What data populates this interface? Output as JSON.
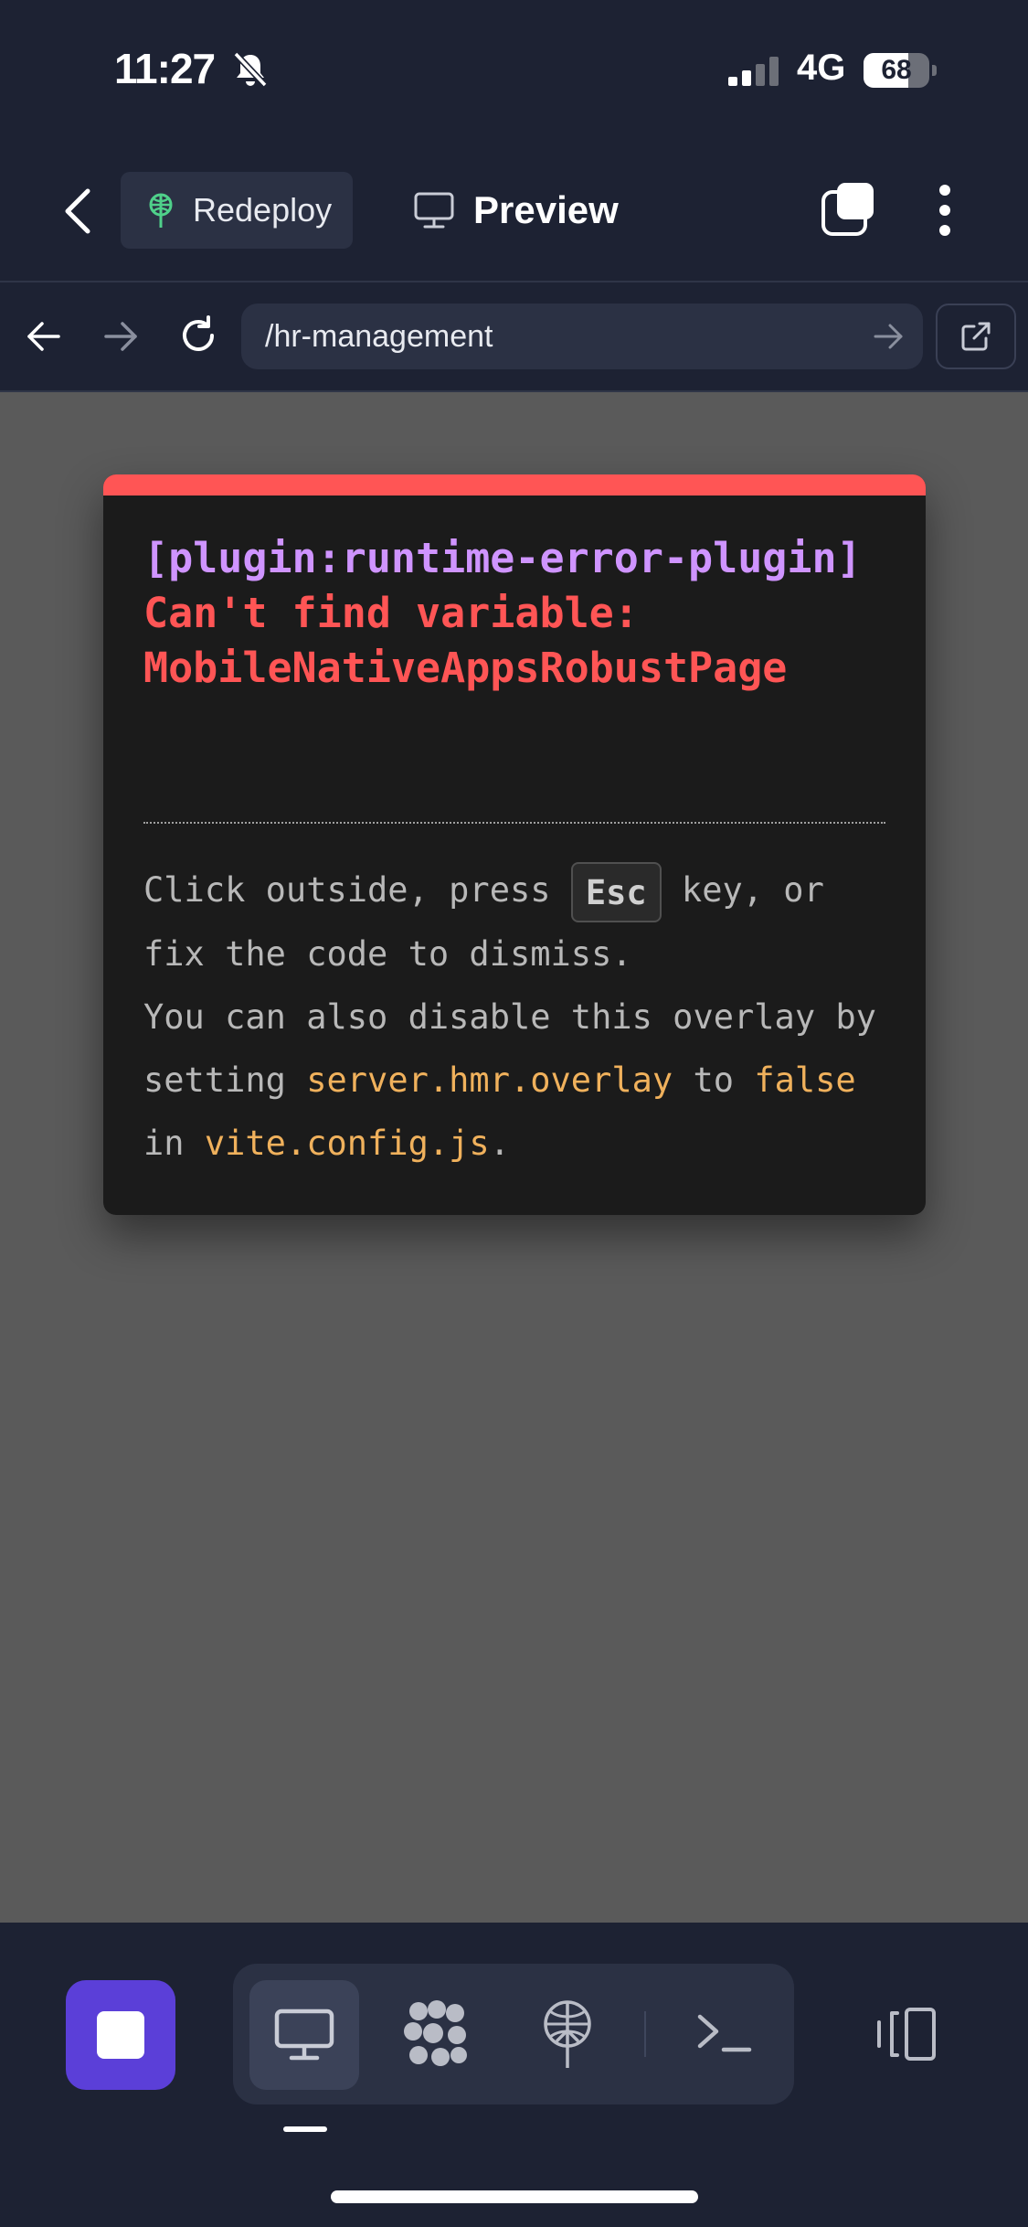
{
  "status_bar": {
    "time": "11:27",
    "network": "4G",
    "battery": "68",
    "battery_level_percent": 68,
    "icons": [
      "bell-slash-icon",
      "signal-icon",
      "battery-icon"
    ]
  },
  "header": {
    "redeploy_label": "Redeploy",
    "preview_label": "Preview",
    "icons": [
      "chevron-left-icon",
      "deploy-icon",
      "monitor-icon",
      "tabs-icon",
      "more-vertical-icon"
    ]
  },
  "url_bar": {
    "path": "/hr-management",
    "icons": [
      "arrow-left-icon",
      "arrow-right-icon",
      "reload-icon",
      "go-arrow-icon",
      "external-link-icon"
    ]
  },
  "error_overlay": {
    "plugin_prefix": "[plugin:runtime-error-plugin]",
    "message": "Can't find variable: MobileNativeAppsRobustPage",
    "tip_click": "Click outside, press",
    "tip_key": "Esc",
    "tip_key_suffix": "key, or fix the code to dismiss.",
    "tip_disable": "You can also disable this overlay by setting",
    "tip_setting": "server.hmr.overlay",
    "tip_to": "to",
    "tip_false": "false",
    "tip_in": "in",
    "tip_config": "vite.config.js",
    "tip_end": ".",
    "colors": {
      "stripe": "#ff5555",
      "plugin": "#cf94ff",
      "message": "#ff5555",
      "code": "#f0b15c"
    }
  },
  "bottom_bar": {
    "icons": [
      "stop-icon",
      "monitor-icon",
      "agents-icon",
      "deploy-icon",
      "terminal-icon",
      "panels-icon"
    ],
    "accent": "#5b3fd8"
  }
}
